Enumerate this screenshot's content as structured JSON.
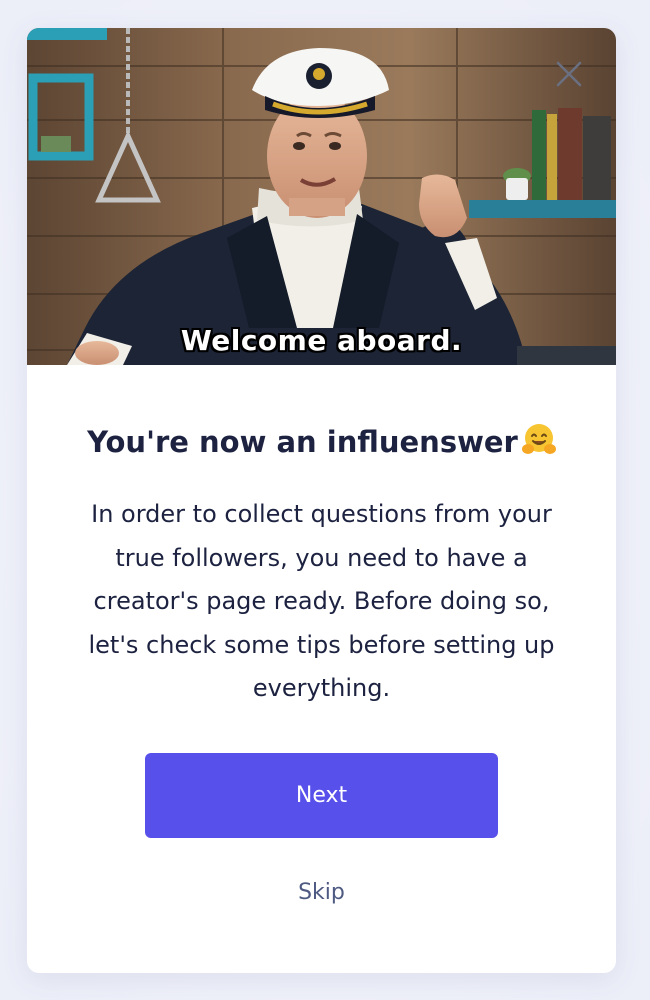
{
  "hero": {
    "caption": "Welcome aboard.",
    "image": "captain-welcome-gif"
  },
  "dialog": {
    "close_icon": "close-icon",
    "title": "You're now an influenswer",
    "title_emoji": "hugging-face-emoji",
    "body": "In order to collect questions from your true followers, you need to have a creator's page ready. Before doing so, let's check some tips before setting up everything.",
    "next_label": "Next",
    "skip_label": "Skip"
  },
  "colors": {
    "primary": "#5750ea",
    "text": "#1c2240",
    "muted": "#4e5a82"
  }
}
